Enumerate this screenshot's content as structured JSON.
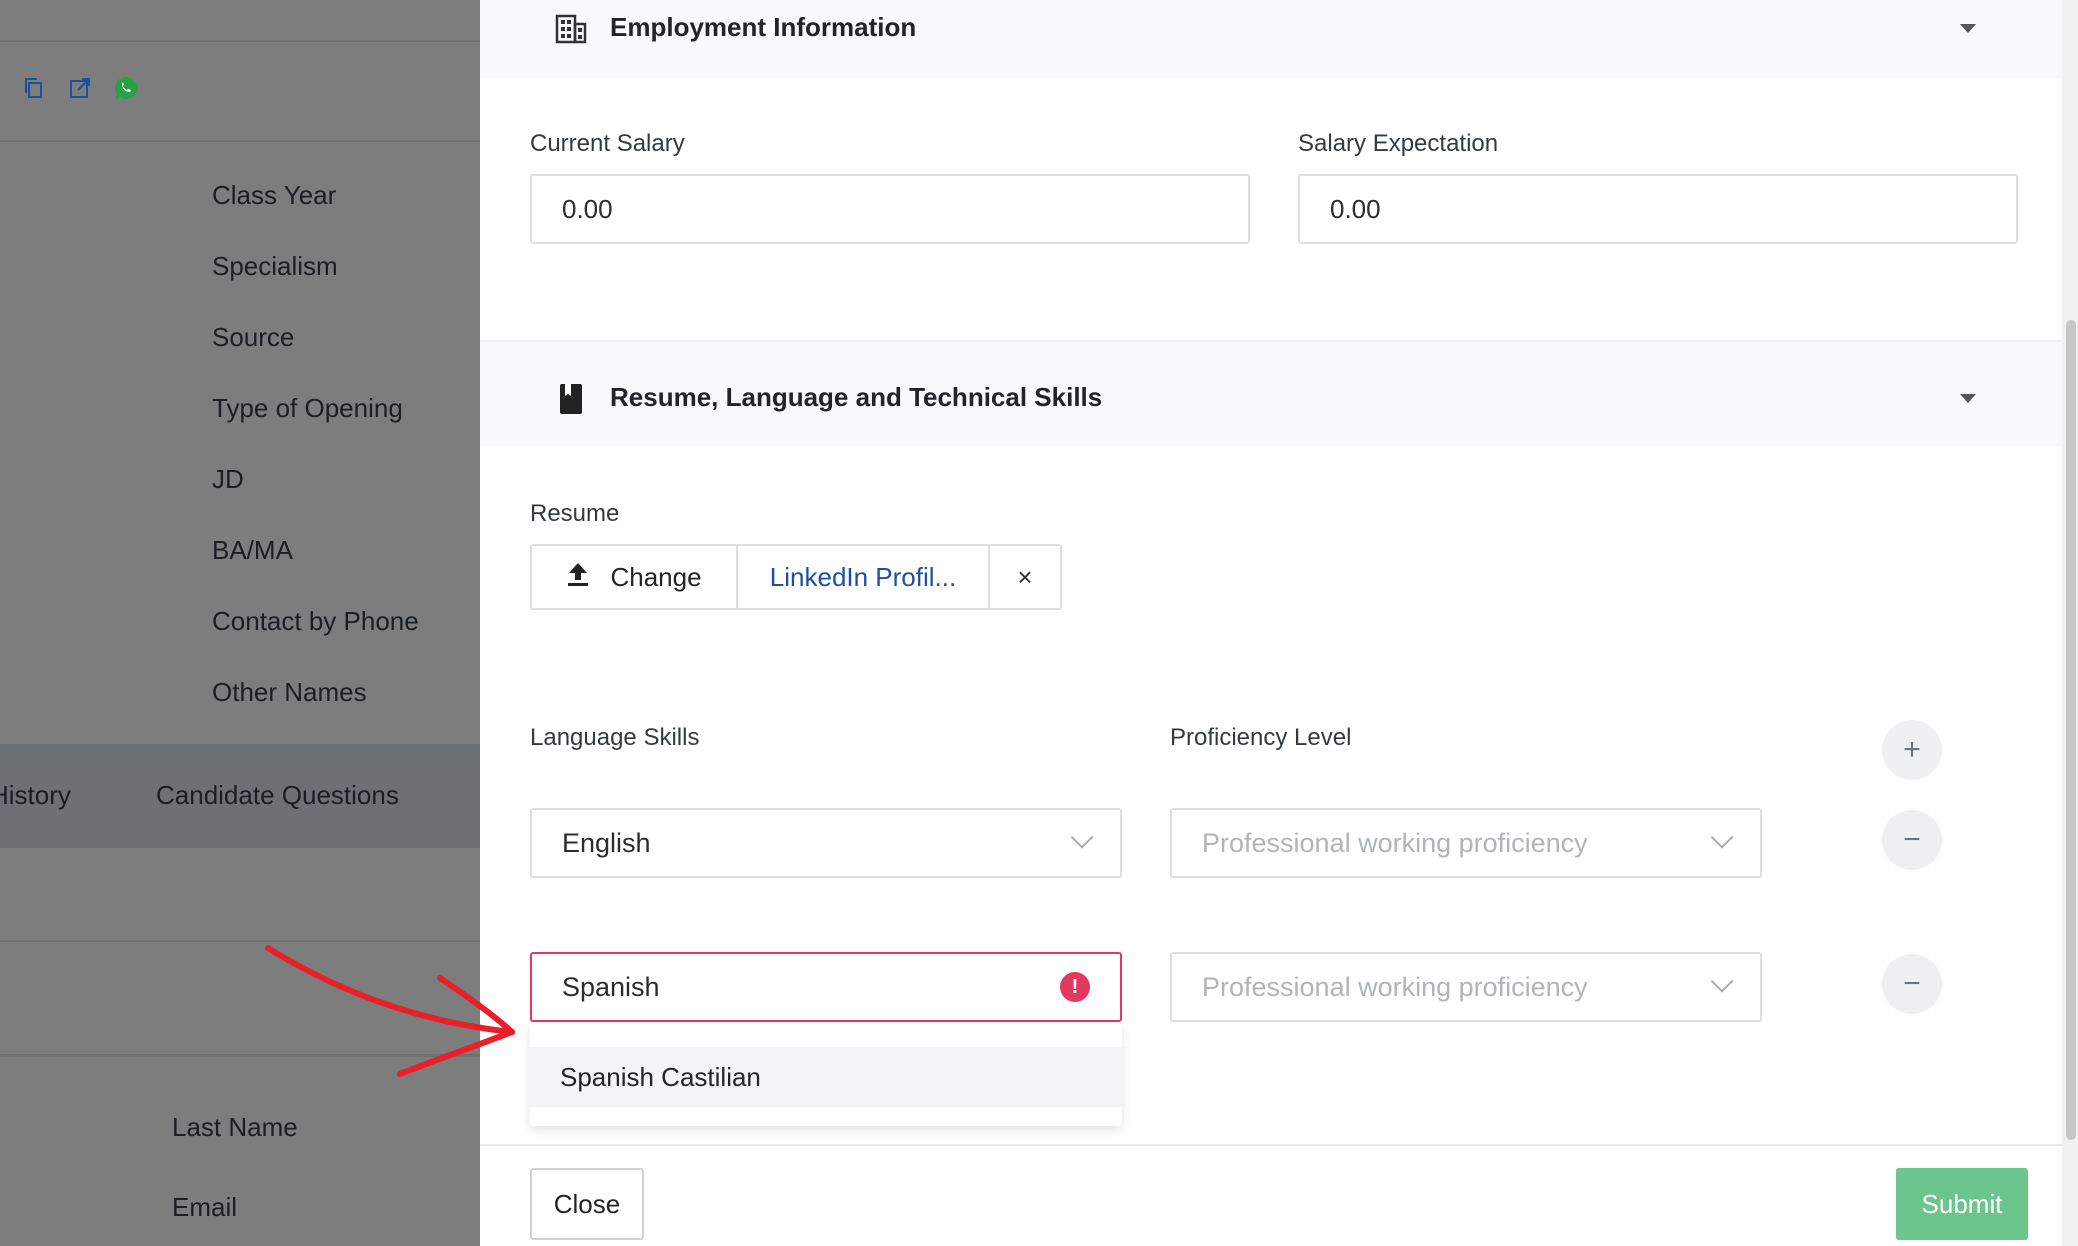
{
  "background": {
    "fields": [
      "Class Year",
      "Specialism",
      "Source",
      "Type of Opening",
      "JD",
      "BA/MA",
      "Contact by Phone",
      "Other Names"
    ],
    "tabs": [
      "History",
      "Candidate Questions"
    ],
    "lower_fields": [
      "Last Name",
      "Email"
    ],
    "icons": [
      "copy-icon",
      "external-link-icon",
      "whatsapp-icon"
    ]
  },
  "employment": {
    "title": "Employment Information",
    "icon": "building-icon",
    "current_salary_label": "Current Salary",
    "current_salary_value": "0.00",
    "salary_expectation_label": "Salary Expectation",
    "salary_expectation_value": "0.00"
  },
  "skills": {
    "title": "Resume, Language and Technical Skills",
    "icon": "book-icon",
    "resume_label": "Resume",
    "change_label": "Change",
    "file_name": "LinkedIn Profil...",
    "clear_symbol": "×",
    "language_label": "Language Skills",
    "proficiency_label": "Proficiency Level",
    "add_symbol": "+",
    "remove_symbol": "−",
    "rows": [
      {
        "language": "English",
        "proficiency": "Professional working proficiency"
      },
      {
        "language": "Spanish",
        "proficiency": "Professional working proficiency"
      }
    ],
    "error_symbol": "!",
    "dropdown_option": "Spanish Castilian"
  },
  "footer": {
    "close_label": "Close",
    "submit_label": "Submit"
  },
  "colors": {
    "error": "#e3395e",
    "submit": "#6cc58d",
    "link": "#1e4fa0",
    "whatsapp": "#25a244",
    "annotation": "#e8202a"
  }
}
